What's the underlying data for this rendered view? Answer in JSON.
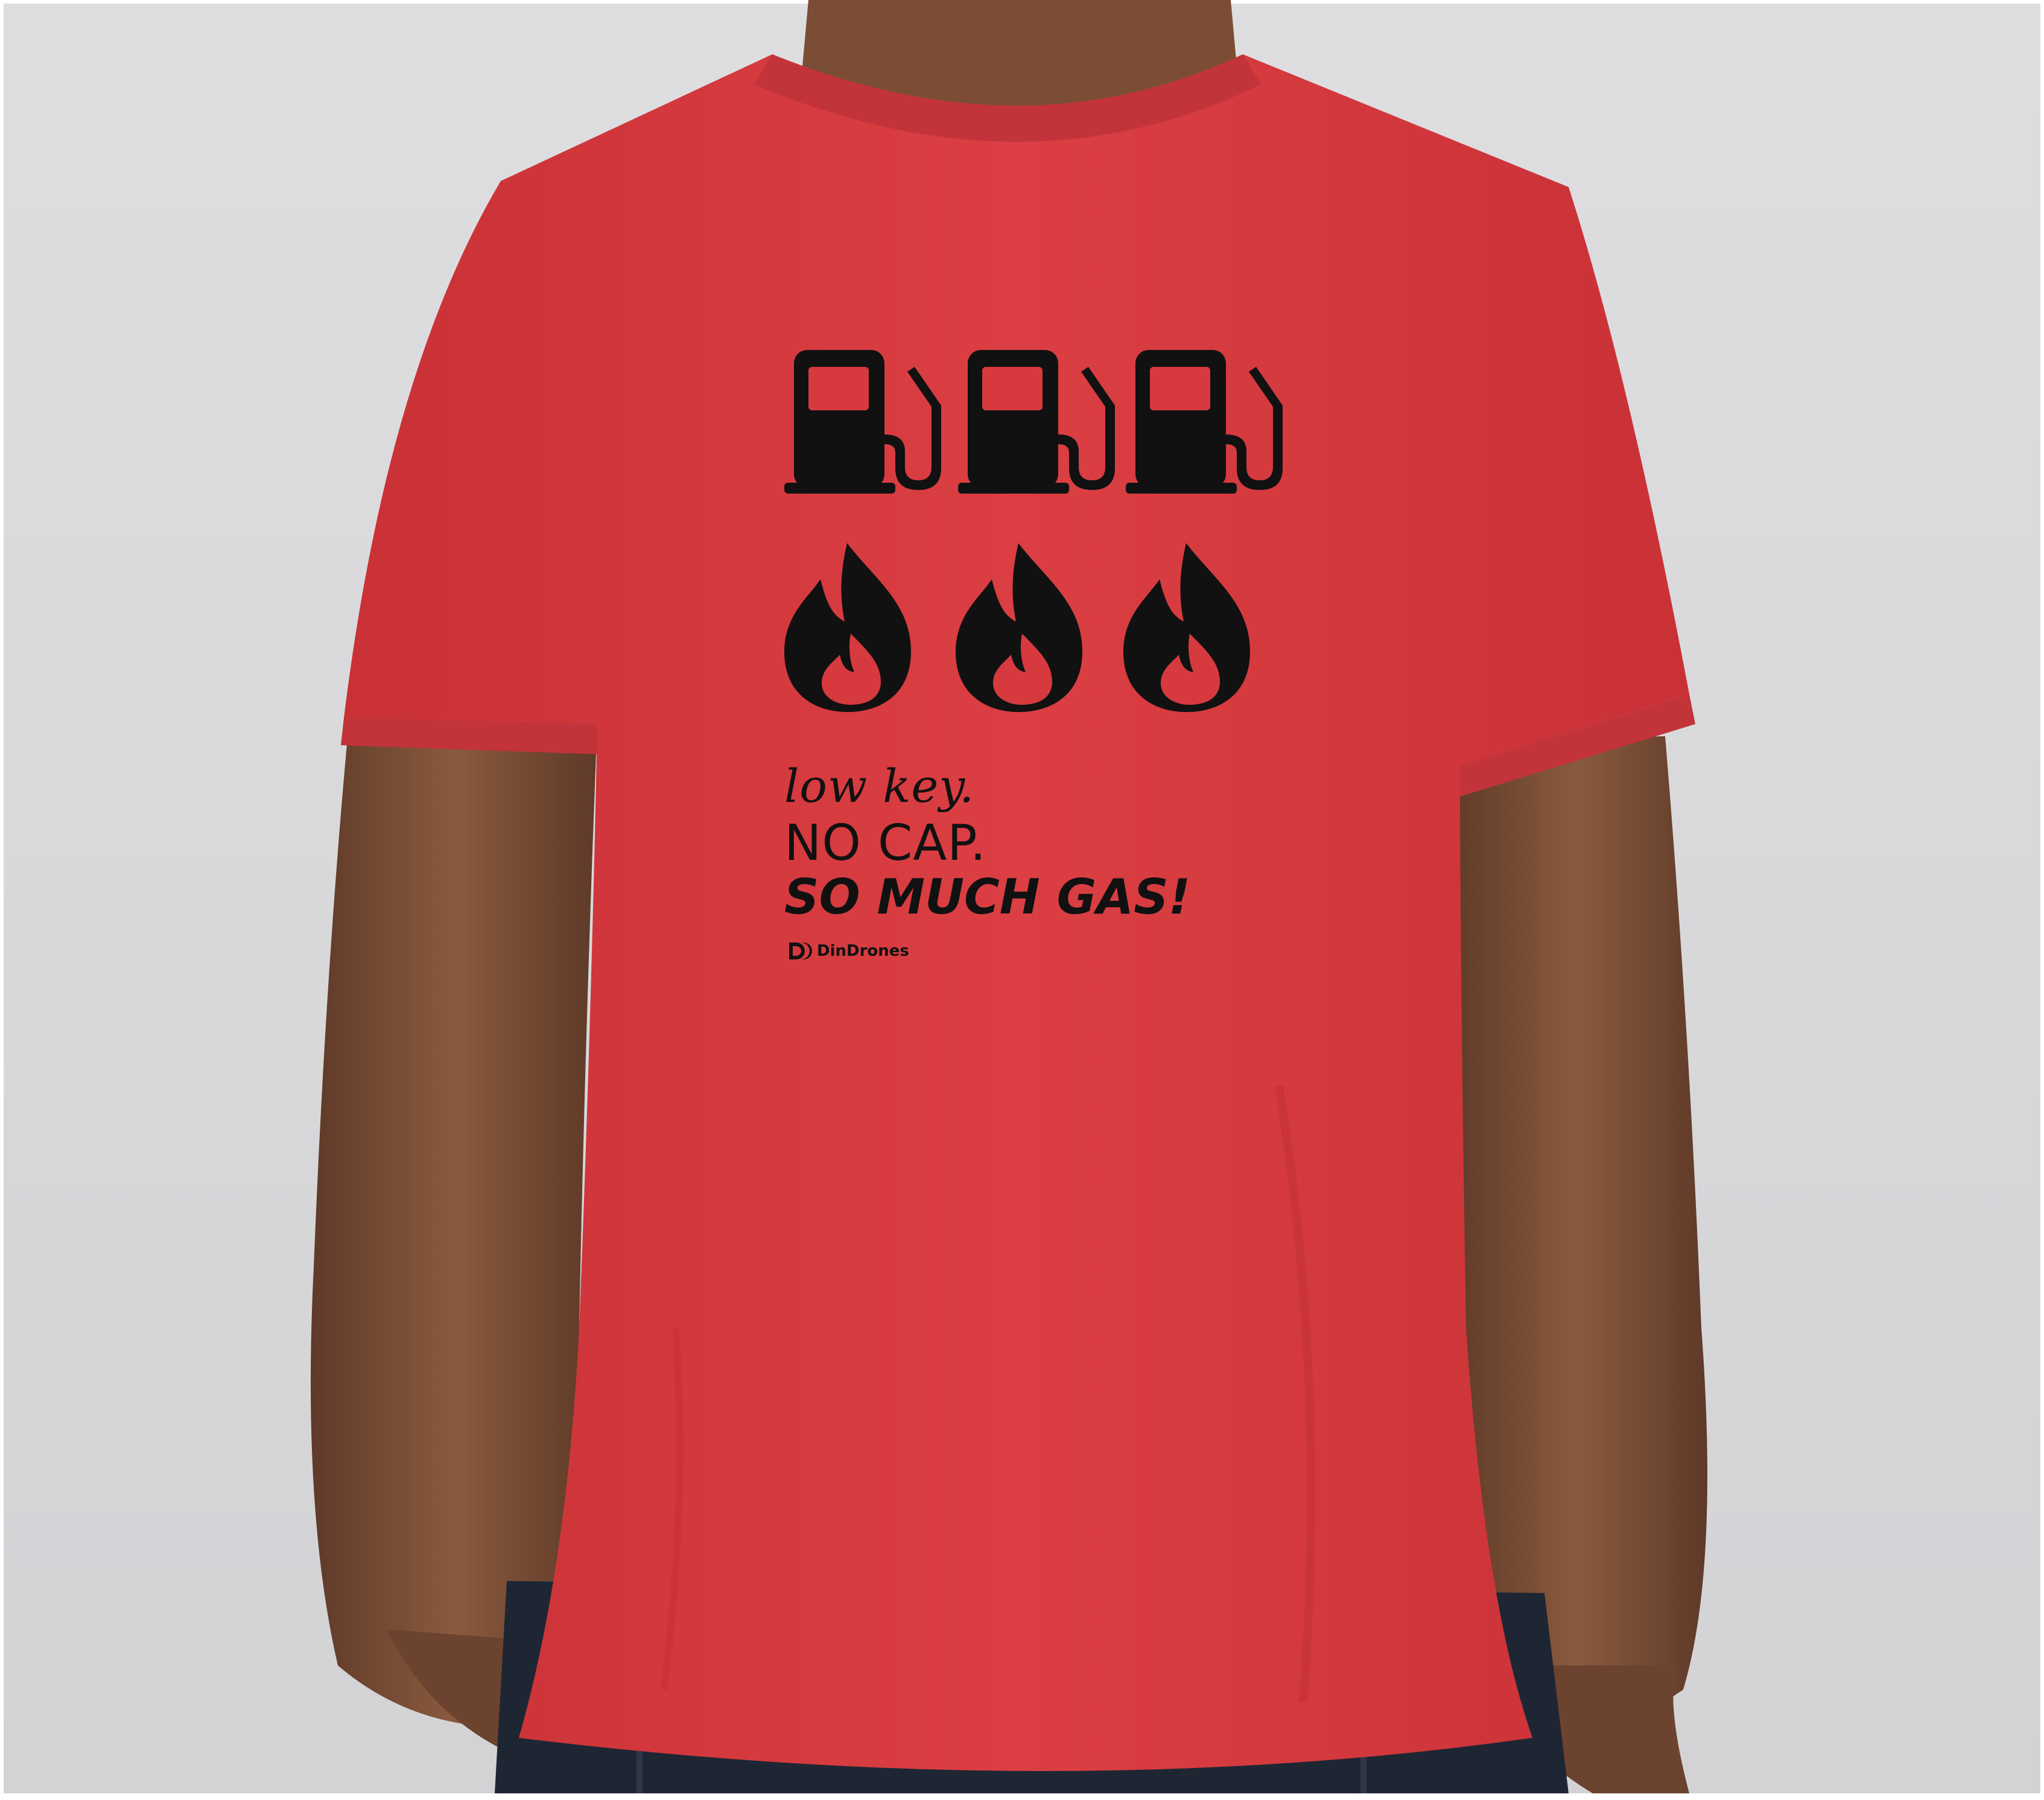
{
  "colors": {
    "background": "#d9d9db",
    "shirt": "#d63a3e",
    "ink": "#111111",
    "skin": "#7a4e36",
    "denim": "#1f2633"
  },
  "icons": {
    "row_1": [
      "gas-pump-icon",
      "gas-pump-icon",
      "gas-pump-icon"
    ],
    "row_2": [
      "flame-icon",
      "flame-icon",
      "flame-icon"
    ]
  },
  "print": {
    "line_1": "low key.",
    "line_2": "NO CAP.",
    "line_3": "SO MUCH GAS!",
    "brand": "DinDrones"
  }
}
